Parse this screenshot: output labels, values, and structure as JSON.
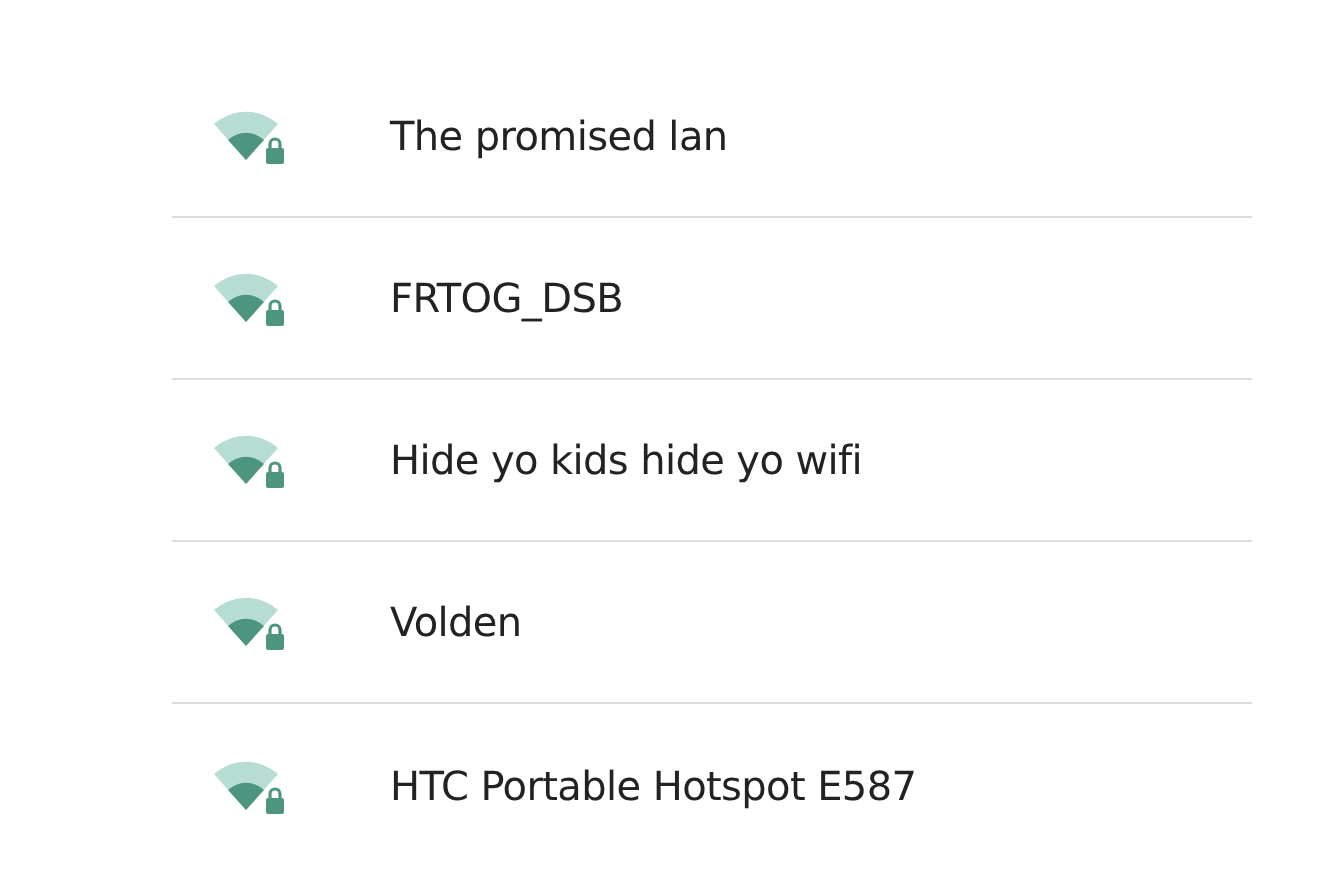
{
  "networks": [
    {
      "name": "The promised lan",
      "secured": true
    },
    {
      "name": "FRTOG_DSB",
      "secured": true
    },
    {
      "name": "Hide yo kids hide yo wifi",
      "secured": true
    },
    {
      "name": "Volden",
      "secured": true
    },
    {
      "name": "HTC Portable Hotspot E587",
      "secured": true
    }
  ]
}
